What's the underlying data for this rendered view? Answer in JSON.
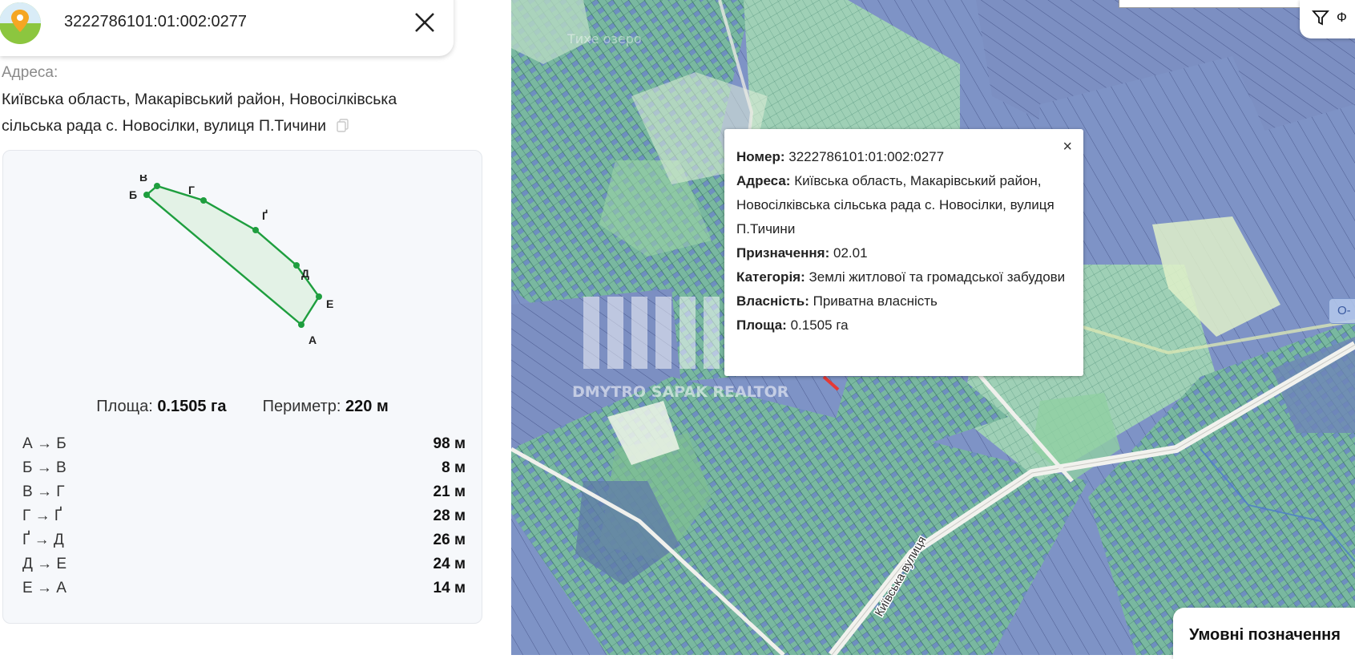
{
  "search": {
    "query": "3222786101:01:002:0277"
  },
  "address": {
    "label": "Адреса:",
    "text": "Київська область, Макарівський район, Новосілківська сільська рада с. Новосілки, вулиця П.Тичини"
  },
  "plot_shape": {
    "vertex_labels": [
      "А",
      "Б",
      "В",
      "Г",
      "Ґ",
      "Д",
      "Е"
    ]
  },
  "stats": {
    "area_label": "Площа:",
    "area_value": "0.1505 га",
    "perimeter_label": "Периметр:",
    "perimeter_value": "220 м"
  },
  "segments": [
    {
      "name": "А → Б",
      "length": "98 м"
    },
    {
      "name": "Б → В",
      "length": "8 м"
    },
    {
      "name": "В → Г",
      "length": "21 м"
    },
    {
      "name": "Г → Ґ",
      "length": "28 м"
    },
    {
      "name": "Ґ → Д",
      "length": "26 м"
    },
    {
      "name": "Д → Е",
      "length": "24 м"
    },
    {
      "name": "Е → А",
      "length": "14 м"
    }
  ],
  "popup": {
    "close": "×",
    "number_label": "Номер:",
    "number_value": "3222786101:01:002:0277",
    "address_label": "Адреса:",
    "address_value": "Київська область, Макарівський район, Новосілківська сільська рада с. Новосілки, вулиця П.Тичини",
    "purpose_label": "Призначення:",
    "purpose_value": "02.01",
    "category_label": "Категорія:",
    "category_value": "Землі житлової та громадської забудови",
    "ownership_label": "Власність:",
    "ownership_value": "Приватна власність",
    "area_label": "Площа:",
    "area_value": "0.1505 га"
  },
  "map": {
    "street_label": "Київська вулиця",
    "watermark_bottom": "DMYTRO SAPAK REALTOR",
    "watermark_top": "Тихе озеро",
    "edge_badge": "О-"
  },
  "legend": {
    "label": "Умовні позначення"
  },
  "filter": {
    "label": "Ф"
  },
  "colors": {
    "parcel_outline": "#1e9e3e",
    "parcel_fill": "#e3f2e6",
    "highlight": "#e53935"
  }
}
